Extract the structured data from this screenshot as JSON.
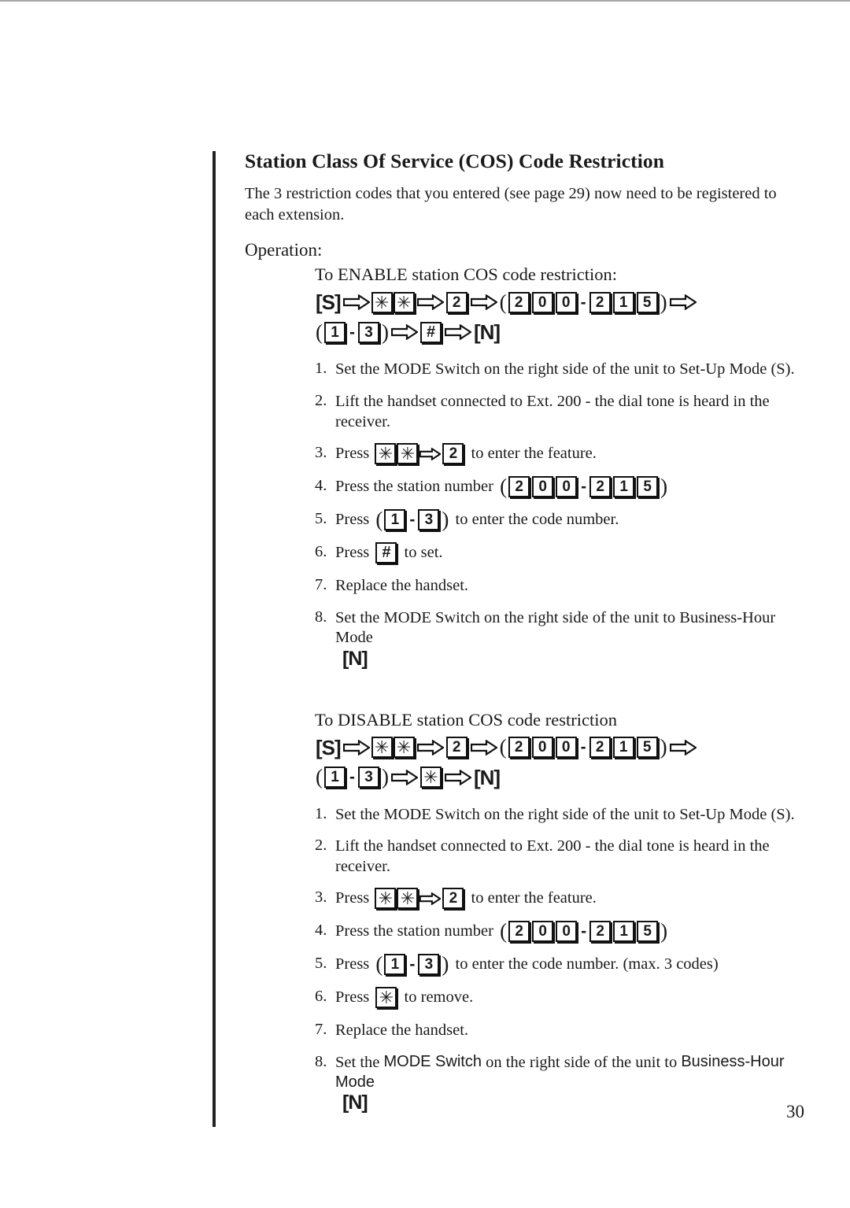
{
  "document": {
    "title": "Station Class Of Service (COS) Code Restriction",
    "intro": "The 3 restriction codes that you entered (see page 29) now need to be registered to each extension.",
    "operation_label": "Operation:",
    "page_number": "30"
  },
  "glyphs": {
    "arrow": "arrow-right-outline",
    "star": "✳",
    "hash": "#",
    "dash": "-",
    "paren_open": "(",
    "paren_close": ")"
  },
  "enable_section": {
    "heading": "To ENABLE station COS code restriction:",
    "sequence_row1": {
      "mode_start": "[S]",
      "star1": "✳",
      "star2": "✳",
      "feature_key": "2",
      "station_from": [
        "2",
        "0",
        "0"
      ],
      "station_to": [
        "2",
        "1",
        "5"
      ]
    },
    "sequence_row2": {
      "code_from": "1",
      "code_to": "3",
      "confirm_key": "#",
      "mode_end": "[N]"
    },
    "steps": [
      {
        "num": "1.",
        "text": "Set the MODE Switch on the right side of the unit to Set-Up Mode (S)."
      },
      {
        "num": "2.",
        "text": "Lift the handset connected to Ext. 200 - the dial tone is heard in the receiver."
      },
      {
        "num": "3.",
        "pre": "Press",
        "post": "to enter the feature.",
        "keys": [
          "✳",
          "✳",
          "2"
        ]
      },
      {
        "num": "4.",
        "pre": "Press the station number",
        "post": "",
        "station_from": [
          "2",
          "0",
          "0"
        ],
        "station_to": [
          "2",
          "1",
          "5"
        ]
      },
      {
        "num": "5.",
        "pre": "Press",
        "post": "to enter the code number.",
        "code_from": "1",
        "code_to": "3"
      },
      {
        "num": "6.",
        "pre": "Press",
        "post": "to set.",
        "key": "#"
      },
      {
        "num": "7.",
        "text": "Replace the handset."
      },
      {
        "num": "8.",
        "text": "Set the MODE Switch on the right side of the unit to Business-Hour Mode",
        "mode": "[N]"
      }
    ]
  },
  "disable_section": {
    "heading": "To DISABLE station COS code restriction",
    "sequence_row1": {
      "mode_start": "[S]",
      "star1": "✳",
      "star2": "✳",
      "feature_key": "2",
      "station_from": [
        "2",
        "0",
        "0"
      ],
      "station_to": [
        "2",
        "1",
        "5"
      ]
    },
    "sequence_row2": {
      "code_from": "1",
      "code_to": "3",
      "confirm_key": "✳",
      "mode_end": "[N]"
    },
    "steps": [
      {
        "num": "1.",
        "text": "Set the MODE Switch on the right side of the unit to Set-Up Mode (S)."
      },
      {
        "num": "2.",
        "text": "Lift the handset connected to Ext. 200 - the dial tone is heard in the receiver."
      },
      {
        "num": "3.",
        "pre": "Press",
        "post": "to enter the feature.",
        "keys": [
          "✳",
          "✳",
          "2"
        ]
      },
      {
        "num": "4.",
        "pre": "Press the station number",
        "post": "",
        "station_from": [
          "2",
          "0",
          "0"
        ],
        "station_to": [
          "2",
          "1",
          "5"
        ]
      },
      {
        "num": "5.",
        "pre": "Press",
        "post": "to enter the code number. (max. 3 codes)",
        "code_from": "1",
        "code_to": "3"
      },
      {
        "num": "6.",
        "pre": "Press",
        "post": "to remove.",
        "key": "✳"
      },
      {
        "num": "7.",
        "text": "Replace the handset."
      },
      {
        "num": "8.",
        "text_a": "Set the ",
        "text_b": "MODE Switch",
        "text_c": " on the right side of the unit to ",
        "text_d": "Business-Hour Mode",
        "mode": "[N]"
      }
    ]
  }
}
